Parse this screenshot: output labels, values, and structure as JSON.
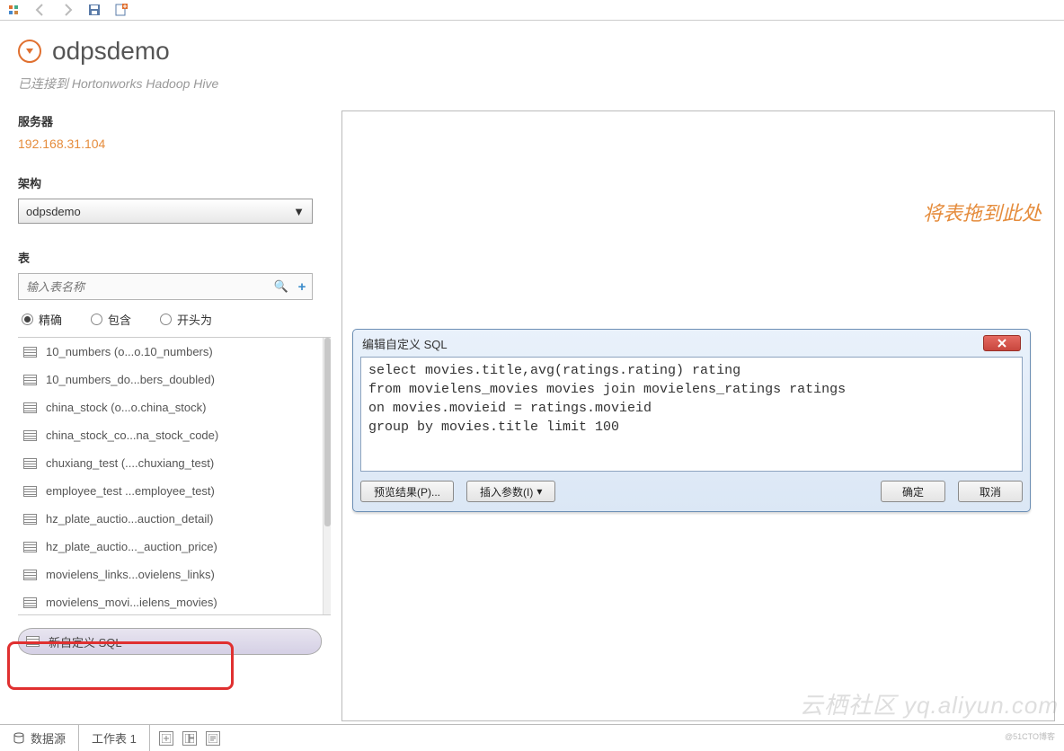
{
  "toolbar": {
    "back": "←",
    "forward": "→"
  },
  "title": "odpsdemo",
  "connected": "已连接到 Hortonworks Hadoop Hive",
  "server": {
    "label": "服务器",
    "ip": "192.168.31.104"
  },
  "schema": {
    "label": "架构",
    "selected": "odpsdemo"
  },
  "tables": {
    "label": "表",
    "placeholder": "输入表名称",
    "radios": {
      "exact": "精确",
      "contains": "包含",
      "startswith": "开头为"
    },
    "items": [
      "10_numbers (o...o.10_numbers)",
      "10_numbers_do...bers_doubled)",
      "china_stock (o...o.china_stock)",
      "china_stock_co...na_stock_code)",
      "chuxiang_test (....chuxiang_test)",
      "employee_test ...employee_test)",
      "hz_plate_auctio...auction_detail)",
      "hz_plate_auctio..._auction_price)",
      "movielens_links...ovielens_links)",
      "movielens_movi...ielens_movies)"
    ]
  },
  "custom_sql_btn": "新自定义 SQL",
  "canvas": {
    "hint": "将表拖到此处"
  },
  "dialog": {
    "title": "编辑自定义 SQL",
    "sql": "select movies.title,avg(ratings.rating) rating\nfrom movielens_movies movies join movielens_ratings ratings\non movies.movieid = ratings.movieid\ngroup by movies.title limit 100",
    "preview": "预览结果(P)...",
    "insert_param": "插入参数(I)",
    "ok": "确定",
    "cancel": "取消"
  },
  "bottom": {
    "datasource": "数据源",
    "worksheet": "工作表 1"
  },
  "watermark": "云栖社区 yq.aliyun.com"
}
